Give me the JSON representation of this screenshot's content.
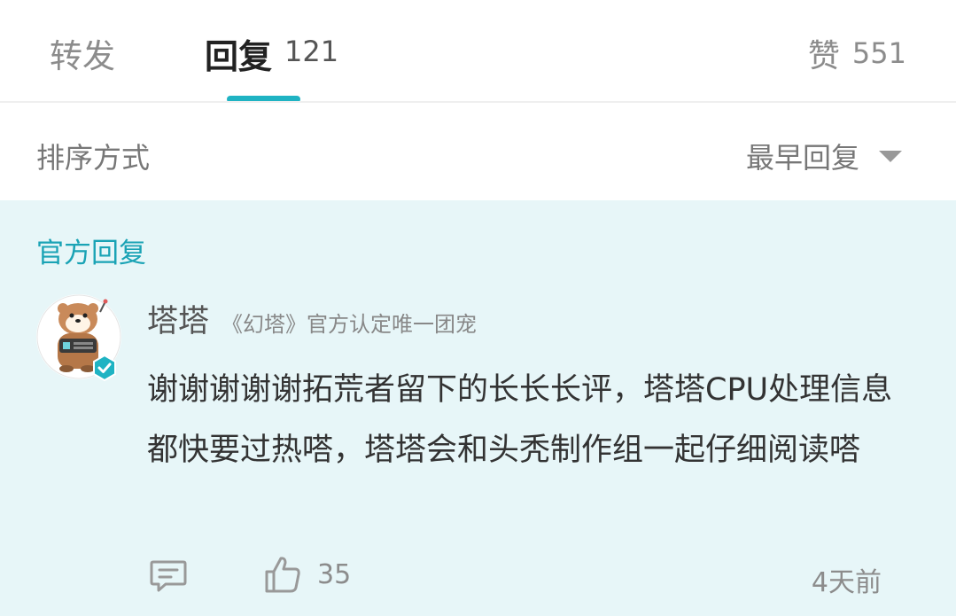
{
  "tabs": {
    "repost_label": "转发",
    "reply_label": "回复",
    "reply_count": "121",
    "like_label": "赞",
    "like_count": "551",
    "active": "reply"
  },
  "sort": {
    "label": "排序方式",
    "value": "最早回复"
  },
  "official_section": {
    "title": "官方回复",
    "comment": {
      "author": "塔塔",
      "author_title": "《幻塔》官方认定唯一团宠",
      "text": "谢谢谢谢谢拓荒者留下的长长长评，塔塔CPU处理信息都快要过热嗒，塔塔会和头秃制作组一起仔细阅读嗒",
      "like_count": "35",
      "time": "4天前",
      "icons": {
        "reply": "comment-icon",
        "like": "thumbs-up-icon",
        "badge": "verified-icon"
      }
    }
  },
  "colors": {
    "accent": "#1fb3c3",
    "official_bg": "#e7f6f8",
    "official_title": "#1aa3b5"
  }
}
